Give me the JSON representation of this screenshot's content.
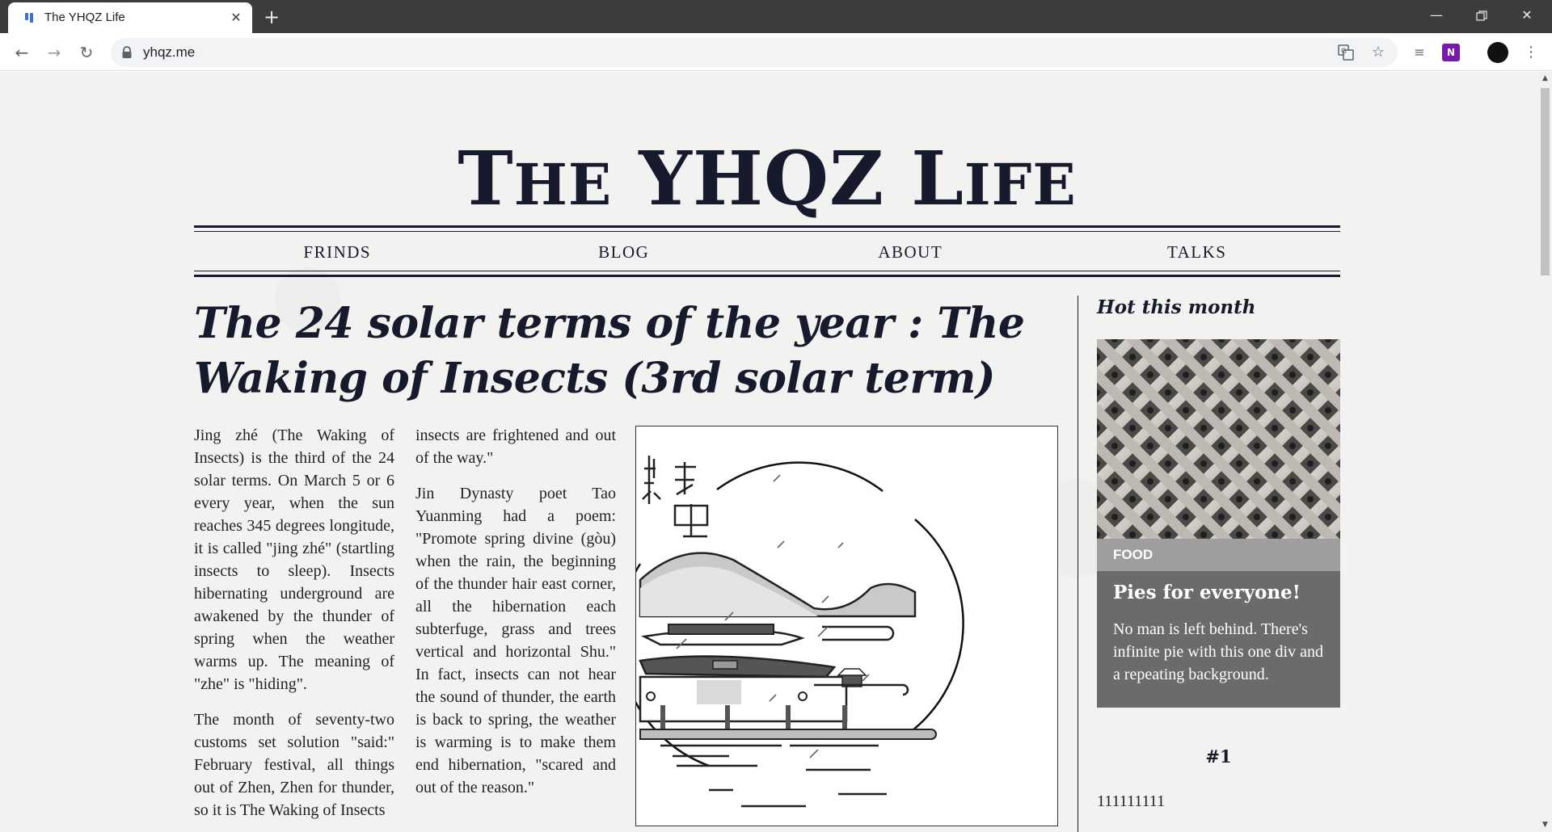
{
  "browser": {
    "tab_title": "The YHQZ Life",
    "url": "yhqz.me",
    "new_tab_symbol": "+",
    "close_symbol": "✕"
  },
  "site": {
    "title_parts": [
      "T",
      "HE",
      " YHQZ L",
      "IFE"
    ],
    "nav": [
      "FRINDS",
      "BLOG",
      "ABOUT",
      "TALKS"
    ]
  },
  "article": {
    "title": "The 24 solar terms of the year : The Waking of Insects (3rd solar term)",
    "col1_p1": "Jing zhé (The Waking of Insects) is the third of the 24 solar terms. On March 5 or 6 every year, when the sun reaches 345 degrees longitude, it is called \"jing zhé\" (startling insects to sleep). Insects hibernating underground are awakened by the thunder of spring when the weather warms up. The meaning of \"zhe\" is \"hiding\".",
    "col1_p2": "The month of seventy-two customs set solution \"said:\" February festival, all things out of Zhen, Zhen for thunder, so it is The Waking of Insects",
    "col2_p1": "insects are frightened and out of the way.\"",
    "col2_p2": "Jin Dynasty poet Tao Yuanming had a poem: \"Promote spring divine (gòu) when the rain, the beginning of the thunder hair east corner, all the hibernation each subterfuge, grass and trees vertical and horizontal Shu.\" In fact, insects can not hear the sound of thunder, the earth is back to spring, the weather is warming is to make them end hibernation, \"scared and out of the reason.\""
  },
  "sidebar": {
    "heading": "Hot this month",
    "card": {
      "tag": "FOOD",
      "title": "Pies for everyone!",
      "body": "No man is left behind. There's infinite pie with this one div and a repeating background."
    },
    "rank": "#1",
    "rank_text": "111111111"
  },
  "colors": {
    "ink": "#171a2c",
    "page_bg": "#f2f2f1",
    "card_bg": "#6b6b6b",
    "card_tag_bg": "#9e9e9e"
  }
}
